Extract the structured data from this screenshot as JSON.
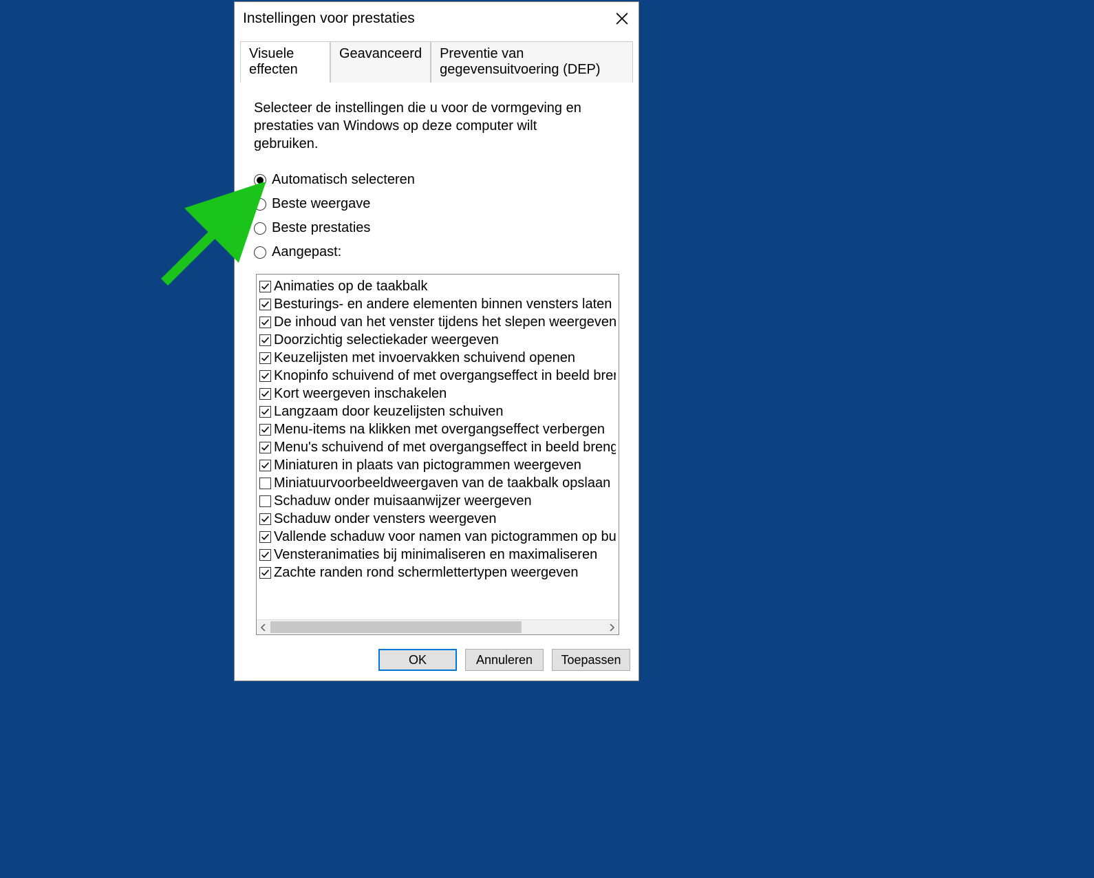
{
  "dialog": {
    "title": "Instellingen voor prestaties",
    "tabs": [
      {
        "label": "Visuele effecten",
        "active": true
      },
      {
        "label": "Geavanceerd",
        "active": false
      },
      {
        "label": "Preventie van gegevensuitvoering (DEP)",
        "active": false
      }
    ],
    "description": "Selecteer de instellingen die u voor de vormgeving en prestaties van Windows op deze computer wilt gebruiken.",
    "radios": [
      {
        "label": "Automatisch selecteren",
        "selected": true
      },
      {
        "label": "Beste weergave",
        "selected": false
      },
      {
        "label": "Beste prestaties",
        "selected": false
      },
      {
        "label": "Aangepast:",
        "selected": false
      }
    ],
    "checkboxes": [
      {
        "label": "Animaties op de taakbalk",
        "checked": true
      },
      {
        "label": "Besturings- en andere elementen binnen vensters laten bewe",
        "checked": true
      },
      {
        "label": "De inhoud van het venster tijdens het slepen weergeven",
        "checked": true
      },
      {
        "label": "Doorzichtig selectiekader weergeven",
        "checked": true
      },
      {
        "label": "Keuzelijsten met invoervakken schuivend openen",
        "checked": true
      },
      {
        "label": "Knopinfo schuivend of met overgangseffect in beeld brengen",
        "checked": true
      },
      {
        "label": "Kort weergeven inschakelen",
        "checked": true
      },
      {
        "label": "Langzaam door keuzelijsten schuiven",
        "checked": true
      },
      {
        "label": "Menu-items na klikken met overgangseffect verbergen",
        "checked": true
      },
      {
        "label": "Menu's schuivend of met overgangseffect in beeld brengen",
        "checked": true
      },
      {
        "label": "Miniaturen in plaats van pictogrammen weergeven",
        "checked": true
      },
      {
        "label": "Miniatuurvoorbeeldweergaven van de taakbalk opslaan",
        "checked": false
      },
      {
        "label": "Schaduw onder muisaanwijzer weergeven",
        "checked": false
      },
      {
        "label": "Schaduw onder vensters weergeven",
        "checked": true
      },
      {
        "label": "Vallende schaduw voor namen van pictogrammen op bureau",
        "checked": true
      },
      {
        "label": "Vensteranimaties bij minimaliseren en maximaliseren",
        "checked": true
      },
      {
        "label": "Zachte randen rond schermlettertypen weergeven",
        "checked": true
      }
    ],
    "buttons": {
      "ok": "OK",
      "cancel": "Annuleren",
      "apply": "Toepassen"
    }
  },
  "annotation": {
    "arrow_color": "#1bc41b"
  }
}
